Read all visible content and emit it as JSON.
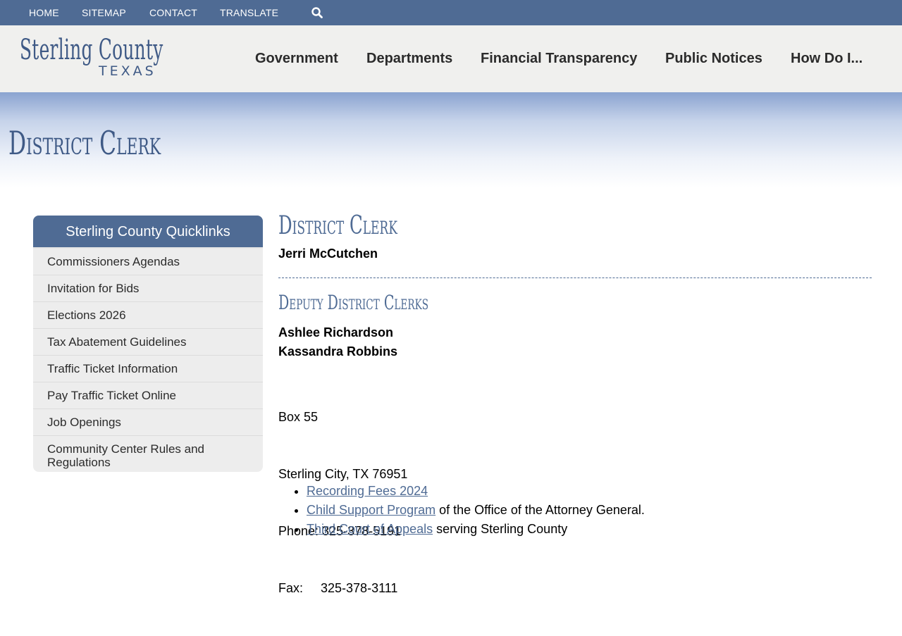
{
  "utility_nav": {
    "home": "HOME",
    "sitemap": "SITEMAP",
    "contact": "CONTACT",
    "translate": "TRANSLATE"
  },
  "logo": {
    "line1": "Sterling County",
    "line2": "TEXAS"
  },
  "main_nav": {
    "government": "Government",
    "departments": "Departments",
    "financial": "Financial Transparency",
    "notices": "Public Notices",
    "howdoi": "How Do I..."
  },
  "banner": {
    "title": "District Clerk"
  },
  "sidebar": {
    "title": "Sterling County Quicklinks",
    "items": [
      "Commissioners Agendas",
      "Invitation for Bids",
      "Elections 2026",
      "Tax Abatement Guidelines",
      "Traffic Ticket Information",
      "Pay Traffic Ticket Online",
      "Job Openings",
      "Community Center Rules and Regulations"
    ]
  },
  "content": {
    "heading": "District Clerk",
    "clerk_name": "Jerri McCutchen",
    "deputies_heading": "Deputy District Clerks",
    "deputies": [
      "Ashlee Richardson",
      "Kassandra Robbins"
    ],
    "address": {
      "box": "Box 55",
      "city": "Sterling City, TX 76951",
      "phone": "Phone: 325-378-5191",
      "fax": "Fax:     325-378-3111"
    },
    "links": [
      {
        "link": "Recording Fees 2024",
        "suffix": ""
      },
      {
        "link": "Child Support Program",
        "suffix": " of the Office of the Attorney General."
      },
      {
        "link": "Third Court of Appeals",
        "suffix": " serving Sterling County"
      }
    ]
  },
  "colors": {
    "brand_blue": "#4f6b94",
    "header_bg": "#f0f0ee",
    "sidebar_bg": "#ededed"
  },
  "icons": {
    "search": "search-icon"
  }
}
